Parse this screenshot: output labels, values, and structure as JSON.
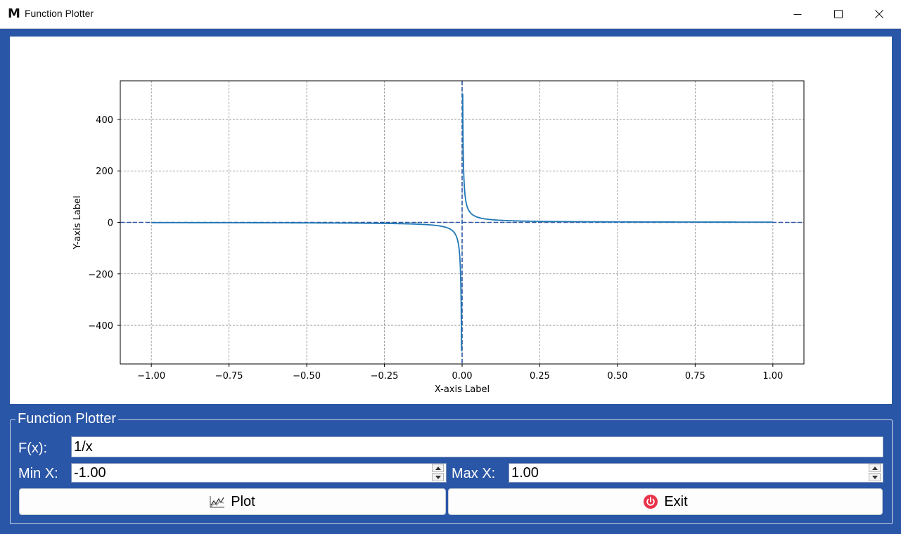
{
  "window": {
    "title": "Function Plotter",
    "icon": "app-m-icon",
    "controls": [
      "minimize-icon",
      "maximize-icon",
      "close-icon"
    ]
  },
  "plot": {
    "xlabel": "X-axis Label",
    "ylabel": "Y-axis Label",
    "xticks": [
      "−1.00",
      "−0.75",
      "−0.50",
      "−0.25",
      "0.00",
      "0.25",
      "0.50",
      "0.75",
      "1.00"
    ],
    "yticks": [
      "400",
      "200",
      "0",
      "−200",
      "−400"
    ]
  },
  "chart_data": {
    "type": "line",
    "function": "1/x",
    "xlim": [
      -1.1,
      1.1
    ],
    "ylim": [
      -550,
      550
    ],
    "grid": true,
    "series_color": "#1f77b4",
    "asymptote_color": "#2a56a7",
    "asymptotes": {
      "vertical_x": 0,
      "horizontal_y": 0
    },
    "x_domain": [
      -1.0,
      1.0
    ]
  },
  "form": {
    "group_title": "Function Plotter",
    "fx_label": "F(x):",
    "fx_value": "1/x",
    "minx_label": "Min X:",
    "minx_value": "-1.00",
    "maxx_label": "Max X:",
    "maxx_value": "1.00",
    "plot_label": "Plot",
    "plot_icon": "chart-icon",
    "exit_label": "Exit",
    "exit_icon": "power-icon"
  },
  "colors": {
    "window_bg": "#2a56a7",
    "exit_icon": "#e8334a"
  }
}
